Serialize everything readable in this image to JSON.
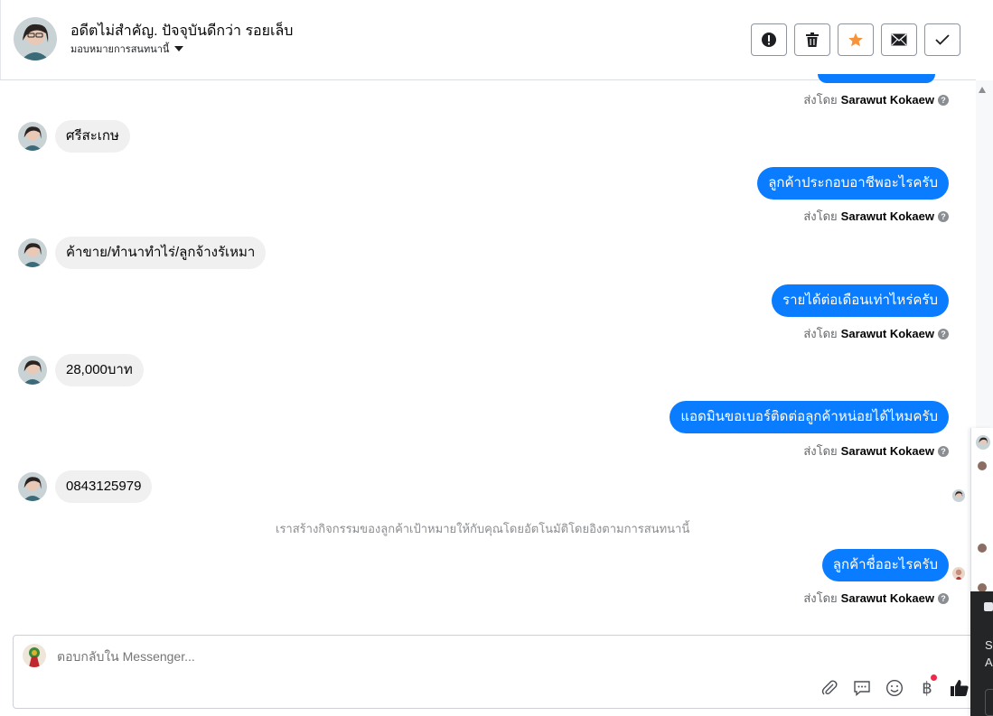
{
  "header": {
    "title": "อดีตไม่สำคัญ. ปัจจุบันดีกว่า รอยเล็บ",
    "assign_label": "มอบหมายการสนทนานี้",
    "actions": [
      {
        "name": "spam-button",
        "icon": "exclamation-icon"
      },
      {
        "name": "delete-button",
        "icon": "trash-icon"
      },
      {
        "name": "star-button",
        "icon": "star-icon",
        "color": "#f7923b"
      },
      {
        "name": "mark-unread-button",
        "icon": "envelope-icon"
      },
      {
        "name": "mark-done-button",
        "icon": "check-icon"
      }
    ]
  },
  "messages": [
    {
      "side": "out",
      "sent_by_prefix": "ส่งโดย",
      "sent_by_name": "Sarawut Kokaew"
    },
    {
      "side": "in",
      "text": "ศรีสะเกษ"
    },
    {
      "side": "out",
      "text": "ลูกค้าประกอบอาชีพอะไรครับ",
      "sent_by_prefix": "ส่งโดย",
      "sent_by_name": "Sarawut Kokaew"
    },
    {
      "side": "in",
      "text": "ค้าขาย/ทำนาทำไร่/ลูกจ้างรัเหมา"
    },
    {
      "side": "out",
      "text": "รายได้ต่อเดือนเท่าไหร่ครับ",
      "sent_by_prefix": "ส่งโดย",
      "sent_by_name": "Sarawut Kokaew"
    },
    {
      "side": "in",
      "text": "28,000บาท"
    },
    {
      "side": "out",
      "text": "แอดมินขอเบอร์ติดต่อลูกค้าหน่อยได้ไหมครับ",
      "sent_by_prefix": "ส่งโดย",
      "sent_by_name": "Sarawut Kokaew"
    },
    {
      "side": "in",
      "text": "0843125979"
    },
    {
      "side": "out",
      "text": "ลูกค้าชื่ออะไรครับ",
      "sent_by_prefix": "ส่งโดย",
      "sent_by_name": "Sarawut Kokaew"
    }
  ],
  "system_note": "เราสร้างกิจกรรมของลูกค้าเป้าหมายให้กับคุณโดยอัตโนมัติโดยอิงตามการสนทนานี้",
  "composer": {
    "placeholder": "ตอบกลับใน Messenger...",
    "tools": [
      "attach-icon",
      "saved-reply-icon",
      "emoji-icon",
      "baht-payment-icon",
      "thumbs-up-icon"
    ]
  },
  "side_panel": {
    "text_1": "Se",
    "text_2": "A"
  },
  "colors": {
    "accent": "#0a7cff",
    "incoming": "#f0f0f0",
    "star": "#f7923b"
  }
}
